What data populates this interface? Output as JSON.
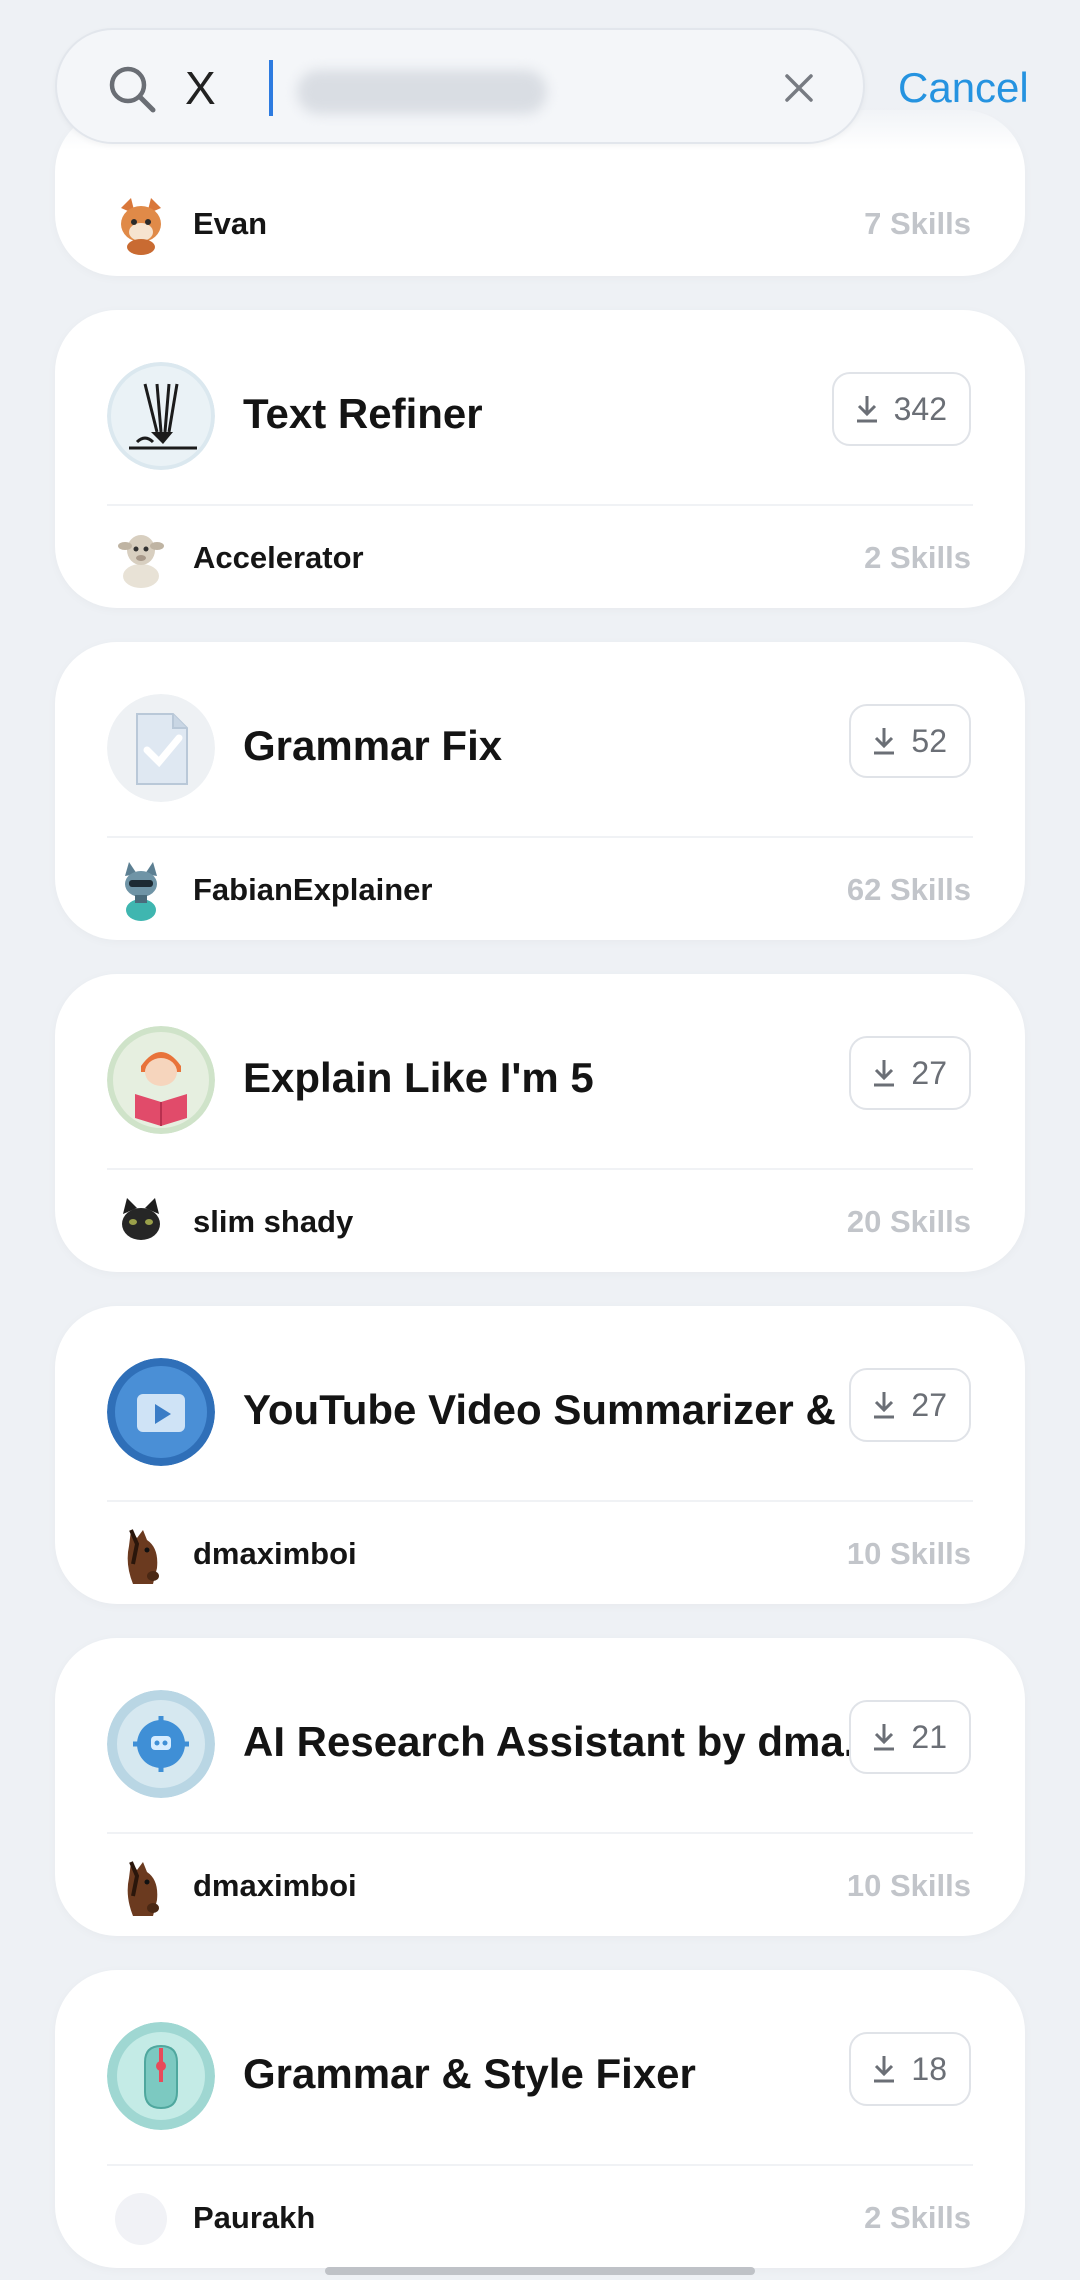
{
  "search": {
    "query": "X",
    "cancel_label": "Cancel"
  },
  "first_author": {
    "name": "Evan",
    "skills": "7 Skills"
  },
  "results": [
    {
      "title": "Text Refiner",
      "downloads": "342",
      "author": "Accelerator",
      "skills": "2 Skills"
    },
    {
      "title": "Grammar Fix",
      "downloads": "52",
      "author": "FabianExplainer",
      "skills": "62 Skills"
    },
    {
      "title": "Explain Like I'm 5",
      "downloads": "27",
      "author": "slim shady",
      "skills": "20 Skills"
    },
    {
      "title": "YouTube Video Summarizer & ...",
      "downloads": "27",
      "author": "dmaximboi",
      "skills": "10 Skills"
    },
    {
      "title": "AI Research Assistant by dma...",
      "downloads": "21",
      "author": "dmaximboi",
      "skills": "10 Skills"
    },
    {
      "title": "Grammar & Style Fixer",
      "downloads": "18",
      "author": "Paurakh",
      "skills": "2 Skills"
    }
  ],
  "icons": {
    "search": "search-icon",
    "clear": "close-icon",
    "download": "download-icon"
  },
  "colors": {
    "accent": "#2593e0",
    "background": "#eef1f5",
    "muted": "#c2c5ca"
  }
}
